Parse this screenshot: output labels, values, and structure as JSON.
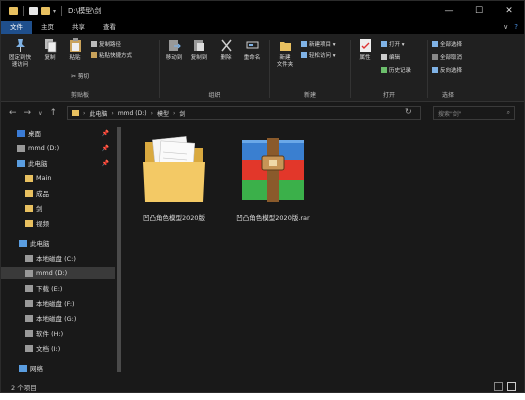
{
  "window": {
    "path_title": "D:\\模型\\剑",
    "min": "—",
    "max": "☐",
    "close": "✕"
  },
  "ribbon_tabs": [
    "文件",
    "主页",
    "共享",
    "查看"
  ],
  "ribbon_right": {
    "collapse": "∨",
    "help": "?"
  },
  "groups": {
    "clipboard": {
      "label": "剪贴板",
      "pin": "固定到快\n速访问",
      "copy": "复制",
      "paste": "粘贴",
      "copy_path": "复制路径",
      "paste_shortcut": "粘贴快捷方式",
      "cut": "剪切"
    },
    "organize": {
      "label": "组织",
      "move_to": "移动到",
      "copy_to": "复制到",
      "delete": "删除",
      "rename": "重命名"
    },
    "new": {
      "label": "新建",
      "new_folder": "新建\n文件夹",
      "new_item": "新建项目 ▾",
      "easy_access": "轻松访问 ▾"
    },
    "open": {
      "label": "打开",
      "properties": "属性",
      "open": "打开 ▾",
      "edit": "编辑",
      "history": "历史记录"
    },
    "select": {
      "label": "选择",
      "select_all": "全部选择",
      "select_none": "全部取消",
      "invert": "反向选择"
    }
  },
  "address": {
    "crumbs": [
      "此电脑",
      "mmd (D:)",
      "模型",
      "剑"
    ],
    "search_placeholder": "搜索\"剑\"",
    "refresh": "↻"
  },
  "nav": {
    "back": "←",
    "forward": "→",
    "recent": "∨",
    "up": "↑"
  },
  "navpane": [
    {
      "label": "桌面",
      "icon": "desktop-icon",
      "pinned": true
    },
    {
      "label": "mmd (D:)",
      "icon": "drive-icon",
      "pinned": true
    },
    {
      "label": "此电脑",
      "icon": "computer-icon",
      "pinned": true
    },
    {
      "label": "Main",
      "icon": "folder-icon",
      "pinned": false
    },
    {
      "label": "成品",
      "icon": "folder-icon",
      "pinned": false
    },
    {
      "label": "剑",
      "icon": "folder-icon",
      "pinned": false
    },
    {
      "label": "视频",
      "icon": "folder-icon",
      "pinned": false
    },
    {
      "label": "此电脑",
      "icon": "computer-icon",
      "pinned": false
    },
    {
      "label": "本地磁盘 (C:)",
      "icon": "drive-icon",
      "pinned": false
    },
    {
      "label": "mmd (D:)",
      "icon": "drive-icon",
      "pinned": false,
      "selected": true
    },
    {
      "label": "下载 (E:)",
      "icon": "drive-icon",
      "pinned": false
    },
    {
      "label": "本地磁盘 (F:)",
      "icon": "drive-icon",
      "pinned": false
    },
    {
      "label": "本地磁盘 (G:)",
      "icon": "drive-icon",
      "pinned": false
    },
    {
      "label": "软件 (H:)",
      "icon": "drive-icon",
      "pinned": false
    },
    {
      "label": "文档 (I:)",
      "icon": "drive-icon",
      "pinned": false
    },
    {
      "label": "网络",
      "icon": "network-icon",
      "pinned": false
    }
  ],
  "files": [
    {
      "name": "凹凸角色模型2020版",
      "type": "folder"
    },
    {
      "name": "凹凸角色模型2020版.rar",
      "type": "rar-archive"
    }
  ],
  "status": {
    "count": "2 个项目"
  },
  "colors": {
    "accent": "#1f4f8c",
    "folder": "#e8c060",
    "background": "#191919"
  }
}
